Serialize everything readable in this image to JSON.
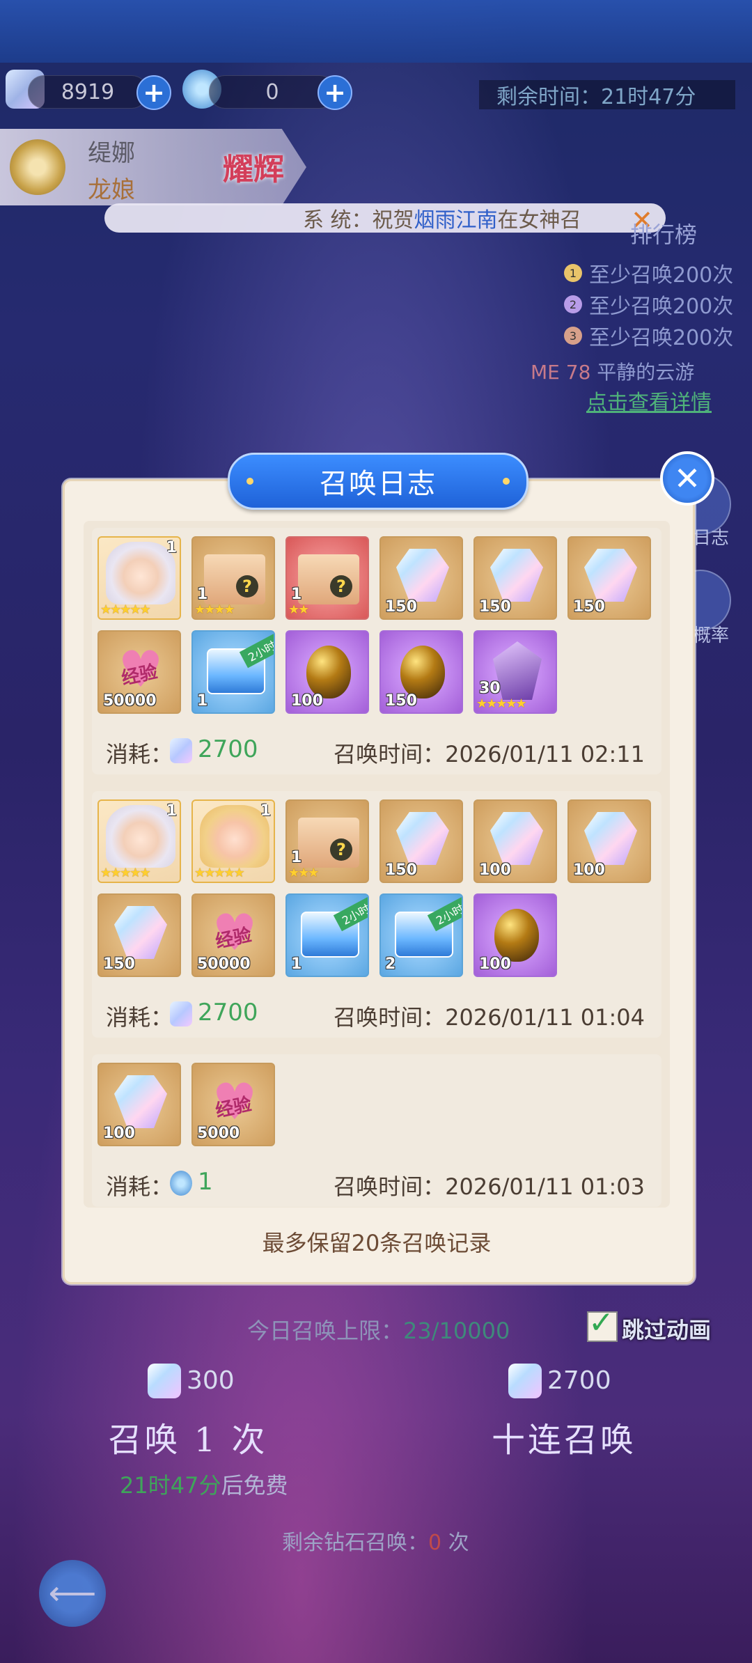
{
  "topbar": {
    "currency1": "8919",
    "currency2": "0",
    "remaining_time_label": "剩余时间：",
    "remaining_time_value": "21时47分"
  },
  "character": {
    "name": "缇娜",
    "title": "龙娘",
    "glory": "耀辉"
  },
  "system_bar": {
    "prefix": "系    统：祝贺",
    "highlight": "烟雨江南",
    "suffix": "在女神召"
  },
  "ranking": {
    "title": "排行榜",
    "rows": [
      "至少召唤200次",
      "至少召唤200次",
      "至少召唤200次"
    ],
    "me_label": "ME 78",
    "me_name": "平静的云游",
    "detail_link": "点击查看详情"
  },
  "side": {
    "log_label": "日志",
    "rate_label": "概率"
  },
  "modal": {
    "title": "召唤日志",
    "footer_note": "最多保留20条召唤记录",
    "cost_label": "消耗：",
    "time_label": "召唤时间：",
    "records": [
      {
        "items": [
          {
            "type": "portrait",
            "qty": "",
            "corner": "1",
            "stars": "★★★★★"
          },
          {
            "type": "box",
            "qty": "1",
            "stars": "★★★★"
          },
          {
            "type": "box-red",
            "qty": "1",
            "stars": "★★"
          },
          {
            "type": "gem",
            "qty": "150"
          },
          {
            "type": "gem",
            "qty": "150"
          },
          {
            "type": "gem",
            "qty": "150"
          },
          {
            "type": "heart",
            "qty": "50000",
            "text": "经验"
          },
          {
            "type": "chest",
            "qty": "1",
            "badge": "2小时"
          },
          {
            "type": "egg",
            "qty": "100"
          },
          {
            "type": "egg",
            "qty": "150"
          },
          {
            "type": "crystal",
            "qty": "30",
            "stars": "★★★★★"
          }
        ],
        "cost": "2700",
        "time": "2026/01/11 02:11"
      },
      {
        "items": [
          {
            "type": "portrait",
            "qty": "",
            "corner": "1",
            "stars": "★★★★★"
          },
          {
            "type": "portrait2",
            "qty": "",
            "corner": "1",
            "stars": "★★★★★"
          },
          {
            "type": "box",
            "qty": "1",
            "stars": "★★★"
          },
          {
            "type": "gem",
            "qty": "150"
          },
          {
            "type": "gem",
            "qty": "100"
          },
          {
            "type": "gem",
            "qty": "100"
          },
          {
            "type": "gem",
            "qty": "150"
          },
          {
            "type": "heart",
            "qty": "50000",
            "text": "经验"
          },
          {
            "type": "chest",
            "qty": "1",
            "badge": "2小时"
          },
          {
            "type": "chest",
            "qty": "2",
            "badge": "2小时"
          },
          {
            "type": "egg",
            "qty": "100"
          }
        ],
        "cost": "2700",
        "time": "2026/01/11 01:04"
      },
      {
        "items": [
          {
            "type": "gem",
            "qty": "100"
          },
          {
            "type": "heart",
            "qty": "5000",
            "text": "经验"
          }
        ],
        "cost": "1",
        "time": "2026/01/11 01:03"
      }
    ]
  },
  "bottom": {
    "limit_label": "今日召唤上限：",
    "limit_value": "23/10000",
    "skip_label": "跳过动画",
    "single_cost": "300",
    "ten_cost": "2700",
    "single_btn": "召唤 1 次",
    "ten_btn": "十连召唤",
    "free_time": "21时47分",
    "free_suffix": "后免费",
    "remain_prefix": "剩余钻石召唤：",
    "remain_value": "0",
    "remain_suffix": "次"
  }
}
